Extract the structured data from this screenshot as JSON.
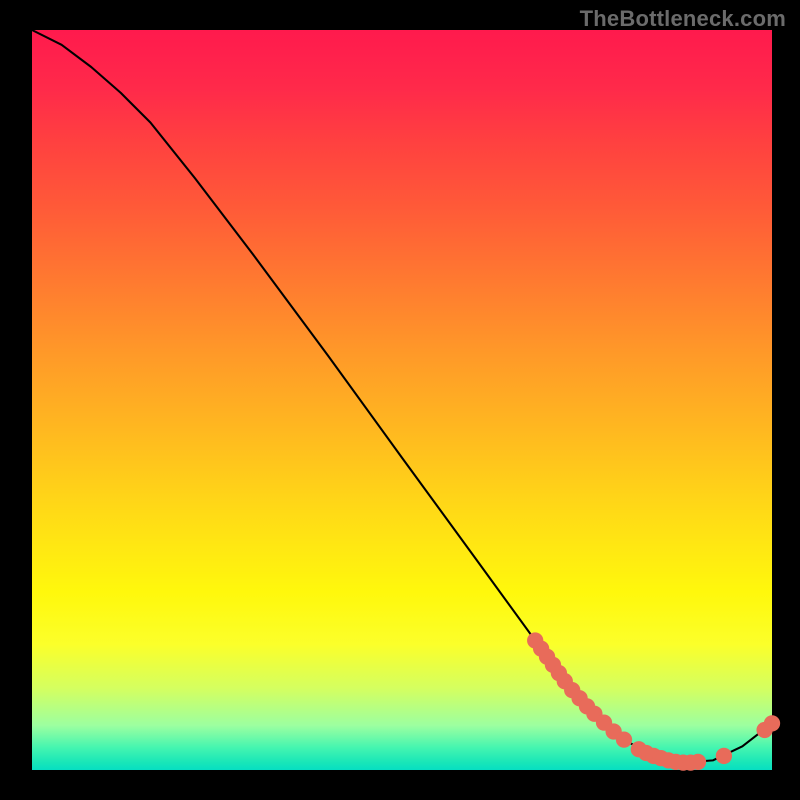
{
  "watermark": "TheBottleneck.com",
  "chart_data": {
    "type": "line",
    "title": "",
    "xlabel": "",
    "ylabel": "",
    "xlim": [
      0,
      100
    ],
    "ylim": [
      0,
      100
    ],
    "grid": false,
    "legend": false,
    "curve": [
      {
        "x": 0,
        "y": 100
      },
      {
        "x": 4,
        "y": 98
      },
      {
        "x": 8,
        "y": 95
      },
      {
        "x": 12,
        "y": 91.5
      },
      {
        "x": 16,
        "y": 87.5
      },
      {
        "x": 22,
        "y": 80
      },
      {
        "x": 30,
        "y": 69.5
      },
      {
        "x": 40,
        "y": 56
      },
      {
        "x": 50,
        "y": 42.2
      },
      {
        "x": 60,
        "y": 28.5
      },
      {
        "x": 68,
        "y": 17.5
      },
      {
        "x": 72,
        "y": 12
      },
      {
        "x": 76,
        "y": 7.6
      },
      {
        "x": 80,
        "y": 4.1
      },
      {
        "x": 84,
        "y": 1.9
      },
      {
        "x": 88,
        "y": 1.0
      },
      {
        "x": 92,
        "y": 1.3
      },
      {
        "x": 96,
        "y": 3.2
      },
      {
        "x": 100,
        "y": 6.3
      }
    ],
    "points": [
      {
        "x": 68,
        "y": 17.5
      },
      {
        "x": 68.8,
        "y": 16.4
      },
      {
        "x": 69.6,
        "y": 15.3
      },
      {
        "x": 70.4,
        "y": 14.2
      },
      {
        "x": 71.2,
        "y": 13.1
      },
      {
        "x": 72,
        "y": 12
      },
      {
        "x": 73,
        "y": 10.8
      },
      {
        "x": 74,
        "y": 9.7
      },
      {
        "x": 75,
        "y": 8.6
      },
      {
        "x": 76,
        "y": 7.6
      },
      {
        "x": 77.3,
        "y": 6.4
      },
      {
        "x": 78.6,
        "y": 5.2
      },
      {
        "x": 80,
        "y": 4.1
      },
      {
        "x": 82,
        "y": 2.8
      },
      {
        "x": 83,
        "y": 2.3
      },
      {
        "x": 84,
        "y": 1.9
      },
      {
        "x": 85,
        "y": 1.6
      },
      {
        "x": 86,
        "y": 1.3
      },
      {
        "x": 87,
        "y": 1.1
      },
      {
        "x": 88,
        "y": 1.0
      },
      {
        "x": 89,
        "y": 1.0
      },
      {
        "x": 90,
        "y": 1.1
      },
      {
        "x": 93.5,
        "y": 1.9
      },
      {
        "x": 99.0,
        "y": 5.4
      },
      {
        "x": 100,
        "y": 6.3
      }
    ],
    "curve_color": "#000000",
    "point_color": "#e86b5a",
    "point_radius": 1.1
  }
}
